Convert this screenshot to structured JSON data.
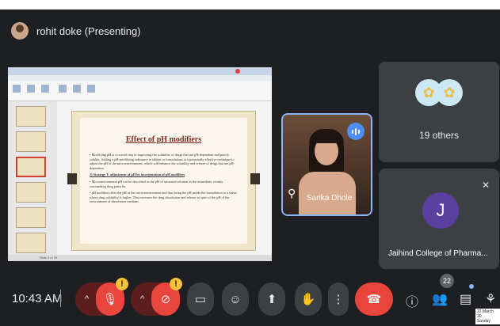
{
  "presenter": {
    "name": "rohit doke (Presenting)"
  },
  "slide": {
    "title": "Effect of pH modifiers",
    "paragraphs": [
      "• Modifying pH is a crucial step in improving the solubility of drugs that are pH-dependent and poorly soluble. Adding a pH-modifying substance to tablets or formulations is a potentially effective technique to adjust the pH of the microenvironment, which will enhance the solubility and release of drugs that are pH-dependent.",
      "1) Strategy 1: adjustment of pH by incorporation of pH modifiers",
      "• Microenvironment pH can be described as the pH of saturated solution in the immediate vicinity surrounding drug particles.",
      "• pH modifiers alter the pH in the microenvironment and thus bring the pH inside the formulation to a value where drug solubility is higher. This increases the drug dissolution and release in spite of the pH of the environment of dissolution medium."
    ],
    "status": "Slide 3 of 20"
  },
  "participants": {
    "sarika": {
      "name": "Sarika Dhole"
    },
    "others": {
      "label": "19 others"
    },
    "jaihind": {
      "initial": "J",
      "name": "Jaihind College of Pharma..."
    }
  },
  "bottom": {
    "time": "10:43 AM",
    "people_count": "22",
    "date_line1": "22 March 20",
    "date_line2": "Sunday"
  }
}
